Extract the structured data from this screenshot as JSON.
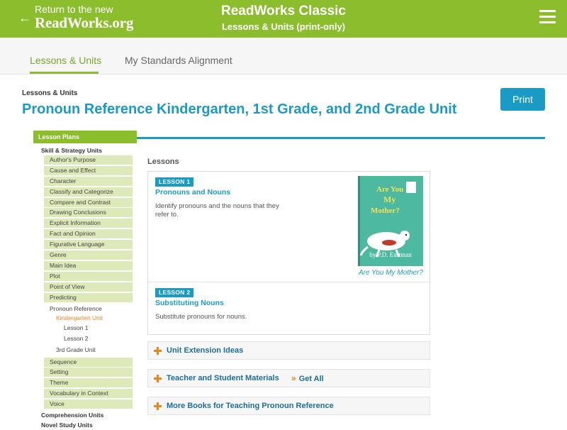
{
  "banner": {
    "back_line1": "Return to the new",
    "back_line2": "ReadWorks.org",
    "back_arrow": "←",
    "site_title": "ReadWorks Classic",
    "site_subtitle": "Lessons & Units (print-only)",
    "menu_icon": "hamburger-icon",
    "color": "#8bbd2c"
  },
  "tabs": [
    {
      "label": "Lessons & Units",
      "active": true
    },
    {
      "label": "My Standards Alignment",
      "active": false
    }
  ],
  "header": {
    "breadcrumb": "Lessons & Units",
    "title": "Pronoun Reference Kindergarten, 1st Grade, and 2nd Grade Unit",
    "print_label": "Print",
    "accent": "#1a9bc6"
  },
  "sidebar": {
    "heading": "Lesson Plans",
    "section_skill": "Skill & Strategy Units",
    "items_top": [
      "Author's Purpose",
      "Cause and Effect",
      "Character",
      "Classify and Categorize",
      "Compare and Contrast",
      "Drawing Conclusions",
      "Explicit Information",
      "Fact and Opinion",
      "Figurative Language",
      "Genre",
      "Main Idea",
      "Plot",
      "Point of View",
      "Predicting"
    ],
    "current_unit": "Pronoun Reference",
    "current_grade": "Kindergarten Unit",
    "lessons": [
      "Lesson 1",
      "Lesson 2"
    ],
    "other_grade": "3rd Grade Unit",
    "items_bottom": [
      "Sequence",
      "Setting",
      "Theme",
      "Vocabulary in Context",
      "Voice"
    ],
    "section_comprehension": "Comprehension Units",
    "section_novel": "Novel Study Units"
  },
  "lessons": {
    "label": "Lessons",
    "items": [
      {
        "badge": "LESSON 1",
        "title": "Pronouns and Nouns",
        "description": "Identify pronouns and the nouns that they refer to.",
        "book_title": "Are You My Mother?",
        "book_author": "by P.D. Eastman"
      },
      {
        "badge": "LESSON 2",
        "title": "Substituting Nouns",
        "description": "Substitute pronouns for nouns."
      }
    ]
  },
  "accordions": {
    "extension": "Unit Extension Ideas",
    "materials": "Teacher and Student Materials",
    "get_all": "Get All",
    "books": "More Books for Teaching Pronoun Reference",
    "icon": "plus-icon"
  }
}
